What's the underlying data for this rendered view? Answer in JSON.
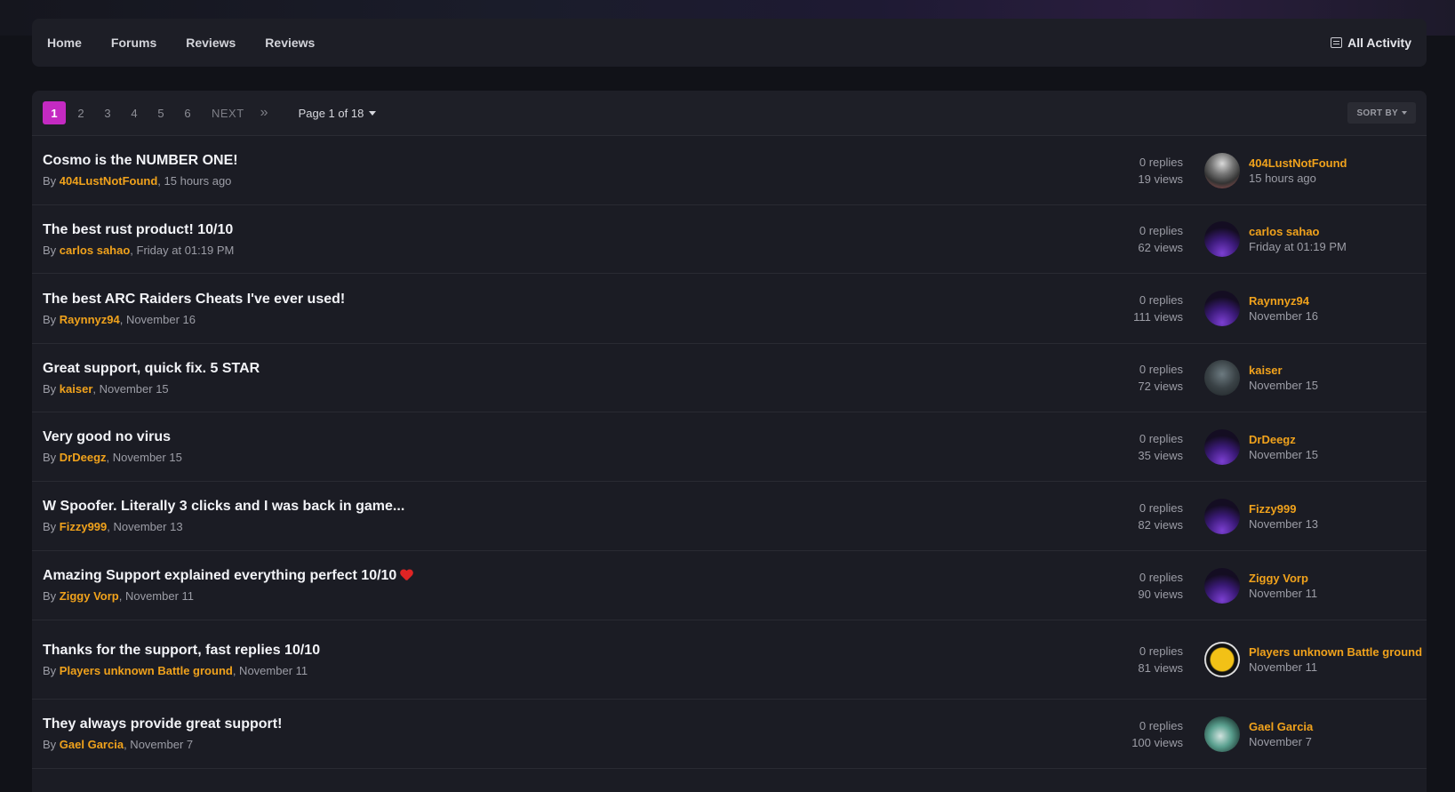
{
  "nav": {
    "links": [
      "Home",
      "Forums",
      "Reviews",
      "Reviews"
    ],
    "all_activity": "All Activity"
  },
  "pager": {
    "pages": [
      "1",
      "2",
      "3",
      "4",
      "5",
      "6"
    ],
    "active_page": "1",
    "next_label": "NEXT",
    "page_jump": "Page 1 of 18",
    "sort_label": "SORT BY"
  },
  "colors": {
    "accent_pink": "#c42ac2",
    "author_orange": "#f0a21c"
  },
  "topics": [
    {
      "title": "Cosmo is the NUMBER ONE!",
      "by": "By ",
      "author": "404LustNotFound",
      "date": ", 15 hours ago",
      "replies": "0 replies",
      "views": "19 views",
      "last_author": "404LustNotFound",
      "last_date": "15 hours ago",
      "avatar": "photo"
    },
    {
      "title": "The best rust product! 10/10",
      "by": "By ",
      "author": "carlos sahao",
      "date": ", Friday at 01:19 PM",
      "replies": "0 replies",
      "views": "62 views",
      "last_author": "carlos sahao",
      "last_date": "Friday at 01:19 PM",
      "avatar": "purple-planet"
    },
    {
      "title": "The best ARC Raiders Cheats I've ever used!",
      "by": "By ",
      "author": "Raynnyz94",
      "date": ", November 16",
      "replies": "0 replies",
      "views": "111 views",
      "last_author": "Raynnyz94",
      "last_date": "November 16",
      "avatar": "purple-planet"
    },
    {
      "title": "Great support, quick fix. 5 STAR",
      "by": "By ",
      "author": "kaiser",
      "date": ", November 15",
      "replies": "0 replies",
      "views": "72 views",
      "last_author": "kaiser",
      "last_date": "November 15",
      "avatar": "photo"
    },
    {
      "title": "Very good no virus",
      "by": "By ",
      "author": "DrDeegz",
      "date": ", November 15",
      "replies": "0 replies",
      "views": "35 views",
      "last_author": "DrDeegz",
      "last_date": "November 15",
      "avatar": "purple-planet"
    },
    {
      "title": "W Spoofer. Literally 3 clicks and I was back in game...",
      "by": "By ",
      "author": "Fizzy999",
      "date": ", November 13",
      "replies": "0 replies",
      "views": "82 views",
      "last_author": "Fizzy999",
      "last_date": "November 13",
      "avatar": "purple-planet"
    },
    {
      "title": "Amazing Support explained everything perfect 10/10",
      "by": "By ",
      "author": "Ziggy Vorp",
      "date": ", November 11",
      "replies": "0 replies",
      "views": "90 views",
      "last_author": "Ziggy Vorp",
      "last_date": "November 11",
      "avatar": "purple-planet"
    },
    {
      "title": "Thanks for the support, fast replies 10/10",
      "by": "By ",
      "author": "Players unknown Battle ground",
      "date": ", November 11",
      "replies": "0 replies",
      "views": "81 views",
      "last_author": "Players unknown Battle ground",
      "last_date": "November 11",
      "avatar": "pubg-logo"
    },
    {
      "title": "They always provide great support!",
      "by": "By ",
      "author": "Gael Garcia",
      "date": ", November 7",
      "replies": "0 replies",
      "views": "100 views",
      "last_author": "Gael Garcia",
      "last_date": "November 7",
      "avatar": "photo"
    }
  ]
}
